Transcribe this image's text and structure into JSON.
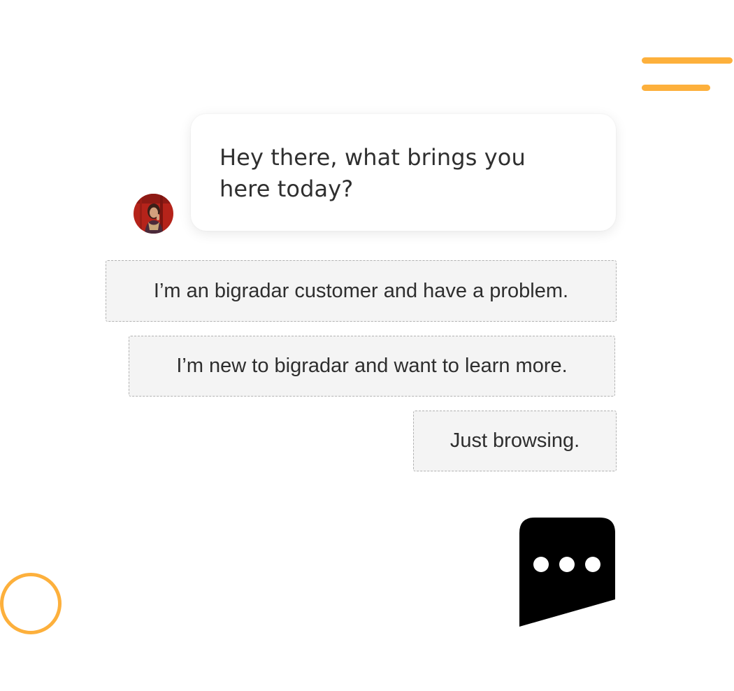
{
  "colors": {
    "accent": "#FDB03C",
    "bubble_background": "#ffffff",
    "option_background": "#f4f4f4",
    "option_border": "#b2b2b2",
    "text": "#2e2e2e",
    "launcher": "#000000"
  },
  "message": {
    "text": "Hey there, what brings you here today?",
    "avatar_icon": "user-avatar"
  },
  "options": [
    {
      "label": "I’m an bigradar customer and have a problem."
    },
    {
      "label": "I’m new to bigradar and want to learn more."
    },
    {
      "label": "Just browsing."
    }
  ],
  "launcher": {
    "icon": "chat-bubble-dots-icon"
  }
}
